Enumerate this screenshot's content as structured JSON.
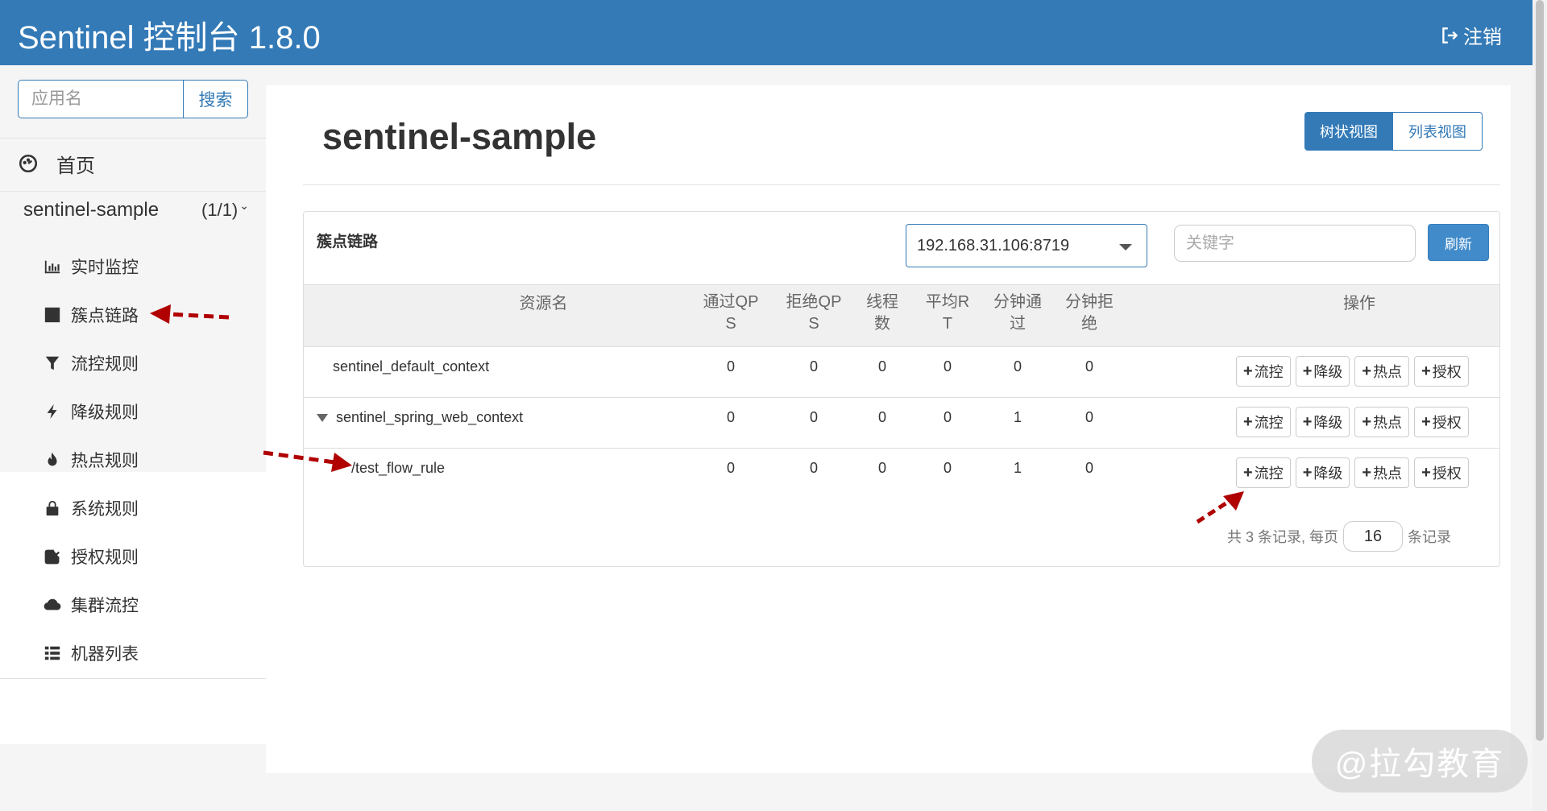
{
  "header": {
    "title": "Sentinel 控制台 1.8.0",
    "logout_label": "注销"
  },
  "sidebar": {
    "search": {
      "placeholder": "应用名",
      "button_label": "搜索"
    },
    "home_label": "首页",
    "app": {
      "name": "sentinel-sample",
      "count": "(1/1)"
    },
    "items": [
      {
        "label": "实时监控",
        "icon": "bar-chart-icon"
      },
      {
        "label": "簇点链路",
        "icon": "list-icon"
      },
      {
        "label": "流控规则",
        "icon": "filter-icon"
      },
      {
        "label": "降级规则",
        "icon": "flash-icon"
      },
      {
        "label": "热点规则",
        "icon": "fire-icon"
      },
      {
        "label": "系统规则",
        "icon": "lock-icon"
      },
      {
        "label": "授权规则",
        "icon": "check-icon"
      },
      {
        "label": "集群流控",
        "icon": "cloud-icon"
      },
      {
        "label": "机器列表",
        "icon": "th-list-icon"
      }
    ]
  },
  "main": {
    "title": "sentinel-sample",
    "view_tree": "树状视图",
    "view_list": "列表视图",
    "card_title": "簇点链路",
    "machine": "192.168.31.106:8719",
    "keyword_placeholder": "关键字",
    "refresh_label": "刷新",
    "columns": {
      "resource": "资源名",
      "pass_qps": [
        "通过QP",
        "S"
      ],
      "block_qps": [
        "拒绝QP",
        "S"
      ],
      "threads": [
        "线程",
        "数"
      ],
      "avg_rt": [
        "平均R",
        "T"
      ],
      "minute_pass": [
        "分钟通",
        "过"
      ],
      "minute_block": [
        "分钟拒",
        "绝"
      ],
      "ops": "操作"
    },
    "rows": [
      {
        "name": "sentinel_default_context",
        "pass_qps": "0",
        "block_qps": "0",
        "threads": "0",
        "avg_rt": "0",
        "minute_pass": "0",
        "minute_block": "0"
      },
      {
        "name": "sentinel_spring_web_context",
        "pass_qps": "0",
        "block_qps": "0",
        "threads": "0",
        "avg_rt": "0",
        "minute_pass": "1",
        "minute_block": "0"
      },
      {
        "name": "/test_flow_rule",
        "pass_qps": "0",
        "block_qps": "0",
        "threads": "0",
        "avg_rt": "0",
        "minute_pass": "1",
        "minute_block": "0"
      }
    ],
    "actions": {
      "flow": "流控",
      "degrade": "降级",
      "hot": "热点",
      "auth": "授权"
    },
    "pager": {
      "prefix": "共 3 条记录, 每页",
      "page_size": "16",
      "suffix": "条记录"
    }
  },
  "watermark": "@拉勾教育",
  "colors": {
    "primary": "#337ab7",
    "annotation_arrow": "#b00000"
  }
}
